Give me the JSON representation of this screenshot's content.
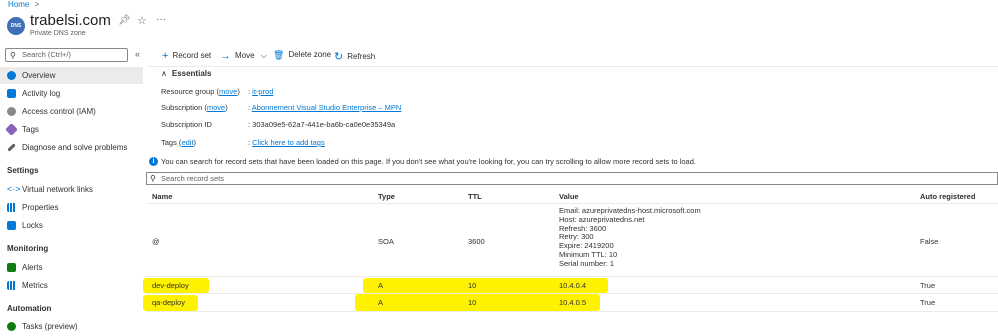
{
  "breadcrumb": {
    "home": "Home",
    "chevron": ">"
  },
  "header": {
    "title": "trabelsi.com",
    "subtitle": "Private DNS zone",
    "icon_text": "DNS"
  },
  "sidebar": {
    "search_placeholder": "Search (Ctrl+/)",
    "collapse_glyph": "«",
    "items": [
      {
        "label": "Overview",
        "color": "#0078d4"
      },
      {
        "label": "Activity log",
        "color": "#0078d4"
      },
      {
        "label": "Access control (IAM)",
        "color": "#605e5c"
      },
      {
        "label": "Tags",
        "color": "#8764b8"
      },
      {
        "label": "Diagnose and solve problems",
        "color": "#605e5c"
      }
    ],
    "sections": [
      {
        "title": "Settings",
        "items": [
          {
            "label": "Virtual network links",
            "color": "#0078d4"
          },
          {
            "label": "Properties",
            "color": "#0078d4"
          },
          {
            "label": "Locks",
            "color": "#0078d4"
          }
        ]
      },
      {
        "title": "Monitoring",
        "items": [
          {
            "label": "Alerts",
            "color": "#107c10"
          },
          {
            "label": "Metrics",
            "color": "#0078d4"
          }
        ]
      },
      {
        "title": "Automation",
        "items": [
          {
            "label": "Tasks (preview)",
            "color": "#107c10"
          }
        ]
      }
    ]
  },
  "toolbar": {
    "record_set": "Record set",
    "move": "Move",
    "delete_zone": "Delete zone",
    "refresh": "Refresh"
  },
  "essentials": {
    "title": "Essentials",
    "resource_group_label": "Resource group",
    "resource_group_move": "move",
    "resource_group_value": "it-prod",
    "subscription_label": "Subscription",
    "subscription_move": "move",
    "subscription_value": "Abonnement Visual Studio Enterprise – MPN",
    "subscription_id_label": "Subscription ID",
    "subscription_id_value": "303a09e5-62a7-441e-ba6b-ca0e0e35349a",
    "tags_label": "Tags",
    "tags_edit": "edit",
    "tags_value": "Click here to add tags"
  },
  "info": "You can search for record sets that have been loaded on this page. If you don't see what you're looking for, you can try scrolling to allow more record sets to load.",
  "record_search_placeholder": "Search record sets",
  "table": {
    "headers": {
      "name": "Name",
      "type": "Type",
      "ttl": "TTL",
      "value": "Value",
      "auto": "Auto registered"
    },
    "soa": {
      "name": "@",
      "type": "SOA",
      "ttl": "3600",
      "auto": "False",
      "values": [
        "Email: azureprivatedns-host.microsoft.com",
        "Host: azureprivatedns.net",
        "Refresh: 3600",
        "Retry: 300",
        "Expire: 2419200",
        "Minimum TTL: 10",
        "Serial number: 1"
      ]
    },
    "rows": [
      {
        "name": "dev-deploy",
        "type": "A",
        "ttl": "10",
        "value": "10.4.0.4",
        "auto": "True"
      },
      {
        "name": "qa-deploy",
        "type": "A",
        "ttl": "10",
        "value": "10.4.0.5",
        "auto": "True"
      }
    ]
  },
  "colors": {
    "accent": "#0078d4",
    "highlight": "#fff200"
  }
}
